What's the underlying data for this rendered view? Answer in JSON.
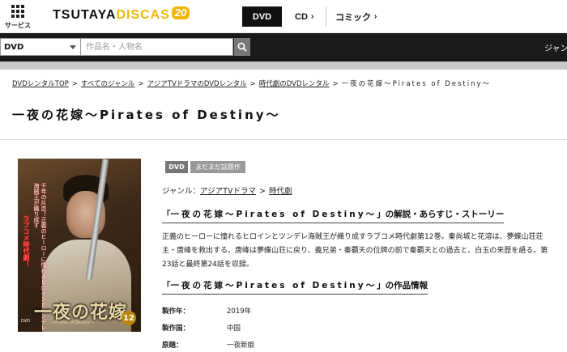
{
  "header": {
    "service_label": "サービス",
    "logo_main": "TSUTAYA",
    "logo_accent": "DISCAS",
    "logo_badge": "20",
    "nav": [
      {
        "label": "DVD",
        "active": true
      },
      {
        "label": "CD",
        "active": false
      },
      {
        "label": "コミック",
        "active": false
      }
    ]
  },
  "search": {
    "category": "DVD",
    "placeholder": "作品名・人物名",
    "right_label": "ジャン"
  },
  "breadcrumb": {
    "items": [
      "DVDレンタルTOP",
      "すべてのジャンル",
      "アジアTVドラマのDVDレンタル",
      "時代劇のDVDレンタル"
    ],
    "current": "一夜の花嫁〜Pirates of Destiny〜"
  },
  "title": "一夜の花嫁〜Pirates of Destiny〜",
  "cover": {
    "title_text": "一夜の花嫁",
    "subtitle_text": "〜Pirates of Destiny〜",
    "volume": "12",
    "side_text": "千年の片恋！正義のヒーローに憧れるヒロインとツンデレ海賊王が織り成す",
    "side_text_red": "ラブコメ時代劇！",
    "format_mark": "DVD"
  },
  "tags": {
    "format": "DVD",
    "status": "まだまだ話題作"
  },
  "genre": {
    "label": "ジャンル：",
    "items": [
      "アジアTVドラマ",
      "時代劇"
    ]
  },
  "synopsis": {
    "heading_prefix": "「",
    "heading_title": "一夜の花嫁〜Pirates of Destiny〜",
    "heading_suffix": "」の解説・あらすじ・ストーリー",
    "text": "正義のヒーローに憧れるヒロインとツンデレ海賊王が織り成すラブコメ時代劇第12巻。秦尚城と花溶は、夢蝶山荘荘主・唐峰を救出する。唐峰は夢蝶山荘に戻り、義兄弟・秦覇天の位牌の前で秦覇天との過去と、白玉の来歴を語る。第23話と最終第24話を収録。"
  },
  "info": {
    "heading_prefix": "「",
    "heading_title": "一夜の花嫁〜Pirates of Destiny〜",
    "heading_suffix": "」の作品情報",
    "rows": [
      {
        "key": "製作年：",
        "value": "2019年"
      },
      {
        "key": "製作国：",
        "value": "中国"
      },
      {
        "key": "原題：",
        "value": "一夜新娘"
      }
    ]
  }
}
